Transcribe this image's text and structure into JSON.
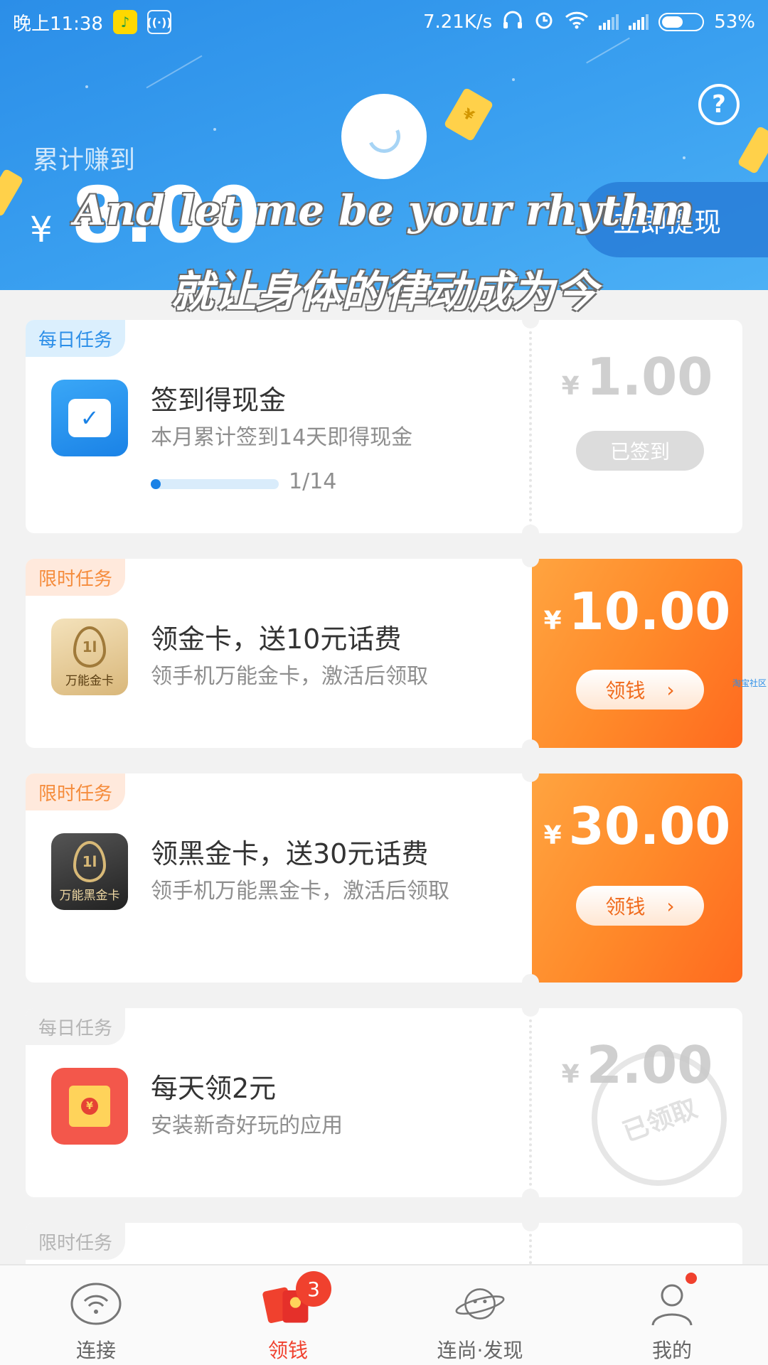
{
  "status_bar": {
    "time": "晚上11:38",
    "net_speed": "7.21K/s",
    "battery": "53%"
  },
  "header": {
    "earned_label": "累计赚到",
    "currency": "¥",
    "earned_amount": "8.00",
    "withdraw_label": "立即提现",
    "help_symbol": "?"
  },
  "lyrics": {
    "line1": "And let me be your rhythm",
    "line2": "就让身体的律动成为今"
  },
  "tasks": [
    {
      "tag": "每日任务",
      "title": "签到得现金",
      "desc": "本月累计签到14天即得现金",
      "progress_text": "1/14",
      "progress": 0.07,
      "currency": "¥",
      "reward": "1.00",
      "button": "已签到"
    },
    {
      "tag": "限时任务",
      "icon_text": "万能金卡",
      "title": "领金卡，送10元话费",
      "desc": "领手机万能金卡，激活后领取",
      "currency": "¥",
      "reward": "10.00",
      "button": "领钱"
    },
    {
      "tag": "限时任务",
      "icon_text": "万能黑金卡",
      "title": "领黑金卡，送30元话费",
      "desc": "领手机万能黑金卡，激活后领取",
      "currency": "¥",
      "reward": "30.00",
      "button": "领钱"
    },
    {
      "tag": "每日任务",
      "title": "每天领2元",
      "desc": "安装新奇好玩的应用",
      "currency": "¥",
      "reward": "2.00",
      "stamp": "已领取"
    },
    {
      "tag": "限时任务"
    }
  ],
  "watermark": "淘宝社区",
  "nav": {
    "items": [
      {
        "label": "连接",
        "icon": "wifi-icon"
      },
      {
        "label": "领钱",
        "icon": "red-envelope-icon",
        "badge": "3"
      },
      {
        "label": "连尚·发现",
        "icon": "planet-face-icon"
      },
      {
        "label": "我的",
        "icon": "user-icon"
      }
    ]
  },
  "colors": {
    "primary_blue": "#2b8ee8",
    "orange": "#ff8a2a",
    "red": "#f0412e"
  }
}
